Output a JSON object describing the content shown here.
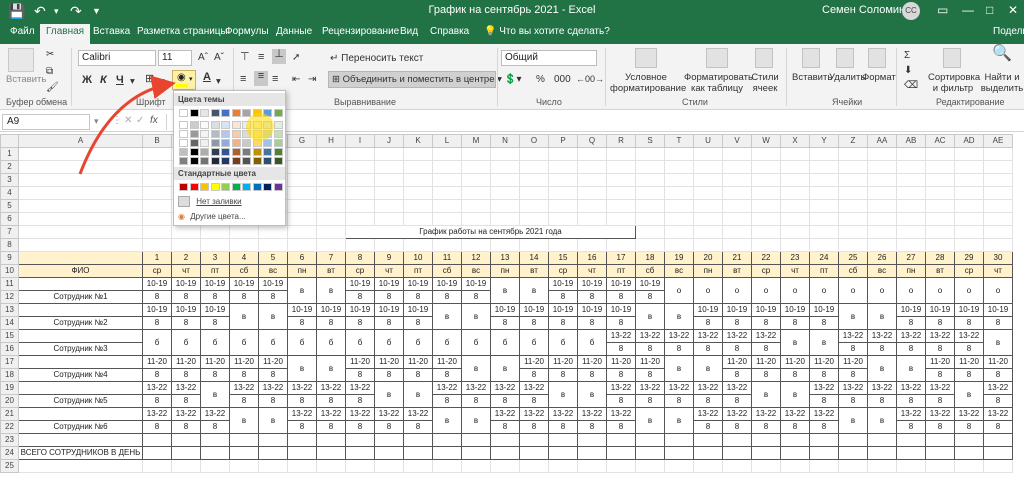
{
  "window": {
    "title": "График на сентябрь 2021  -  Excel",
    "user": "Семен Соломин",
    "avatar": "СС",
    "qat_icons": [
      "save-icon",
      "undo-icon",
      "redo-icon",
      "qat-dropdown-icon"
    ],
    "controls": [
      "ribbon-display-icon",
      "minimize-icon",
      "restore-icon",
      "close-icon"
    ]
  },
  "tabs": [
    "Файл",
    "Главная",
    "Вставка",
    "Разметка страницы",
    "Формулы",
    "Данные",
    "Рецензирование",
    "Вид",
    "Справка"
  ],
  "tell_me": "Что вы хотите сделать?",
  "share": "Поделит",
  "ribbon": {
    "clipboard": {
      "paste": "Вставить",
      "label": "Буфер обмена"
    },
    "font": {
      "name": "Calibri",
      "size": "11",
      "bold": "Ж",
      "italic": "К",
      "underline": "Ч",
      "label": "Шрифт"
    },
    "alignment": {
      "wrap": "Переносить текст",
      "merge": "Объединить и поместить в центре",
      "label": "Выравнивание"
    },
    "number": {
      "format": "Общий",
      "label": "Число"
    },
    "styles": {
      "conditional": "Условное форматирование",
      "as_table": "Форматировать как таблицу",
      "cell_styles": "Стили ячеек",
      "label": "Стили"
    },
    "cells": {
      "insert": "Вставить",
      "delete": "Удалить",
      "format": "Формат",
      "label": "Ячейки"
    },
    "editing": {
      "sort": "Сортировка и фильтр",
      "find": "Найти и выделить",
      "label": "Редактирование"
    }
  },
  "formula_bar": {
    "name_box": "A9",
    "fx": "fx",
    "value": ""
  },
  "fill_dropdown": {
    "theme_title": "Цвета темы",
    "standard_title": "Стандартные цвета",
    "no_fill": "Нет заливки",
    "more_colors": "Другие цвета...",
    "theme_colors": [
      "#ffffff",
      "#000000",
      "#e7e6e6",
      "#44546a",
      "#4472c4",
      "#ed7d31",
      "#a5a5a5",
      "#ffc000",
      "#5b9bd5",
      "#70ad47"
    ],
    "standard_colors": [
      "#c00000",
      "#ff0000",
      "#ffc000",
      "#ffff00",
      "#92d050",
      "#00b050",
      "#00b0f0",
      "#0070c0",
      "#002060",
      "#7030a0"
    ]
  },
  "sheet": {
    "columns": [
      "A",
      "B",
      "C",
      "D",
      "E",
      "F",
      "G",
      "H",
      "I",
      "J",
      "K",
      "L",
      "M",
      "N",
      "O",
      "P",
      "Q",
      "R",
      "S",
      "T",
      "U",
      "V",
      "W",
      "X",
      "Y",
      "Z",
      "AA",
      "AB",
      "AC",
      "AD",
      "AE"
    ],
    "rows": [
      1,
      2,
      3,
      4,
      5,
      6,
      7,
      8,
      9,
      10,
      11,
      12,
      13,
      14,
      15,
      16,
      17,
      18,
      19,
      20,
      21,
      22,
      23,
      24,
      25
    ],
    "schedule_title": "График работы на сентябрь 2021 года",
    "fio_header": "ФИО",
    "days": [
      "1",
      "2",
      "3",
      "4",
      "5",
      "6",
      "7",
      "8",
      "9",
      "10",
      "11",
      "12",
      "13",
      "14",
      "15",
      "16",
      "17",
      "18",
      "19",
      "20",
      "21",
      "22",
      "23",
      "24",
      "25",
      "26",
      "27",
      "28",
      "29",
      "30"
    ],
    "weekdays": [
      "ср",
      "чт",
      "пт",
      "сб",
      "вс",
      "пн",
      "вт",
      "ср",
      "чт",
      "пт",
      "сб",
      "вс",
      "пн",
      "вт",
      "ср",
      "чт",
      "пт",
      "сб",
      "вс",
      "пн",
      "вт",
      "ср",
      "чт",
      "пт",
      "сб",
      "вс",
      "пн",
      "вт",
      "ср",
      "чт"
    ],
    "employees": [
      {
        "name": "Сотрудник №1",
        "cells": [
          "10-19|8",
          "10-19|8",
          "10-19|8",
          "10-19|8",
          "10-19|8",
          "в",
          "в",
          "10-19|8",
          "10-19|8",
          "10-19|8",
          "10-19|8",
          "10-19|8",
          "в",
          "в",
          "10-19|8",
          "10-19|8",
          "10-19|8",
          "10-19|8",
          "о",
          "о",
          "о",
          "о",
          "о",
          "о",
          "о",
          "о",
          "о",
          "о",
          "о",
          "о"
        ]
      },
      {
        "name": "Сотрудник №2",
        "cells": [
          "10-19|8",
          "10-19|8",
          "10-19|8",
          "в",
          "в",
          "10-19|8",
          "10-19|8",
          "10-19|8",
          "10-19|8",
          "10-19|8",
          "в",
          "в",
          "10-19|8",
          "10-19|8",
          "10-19|8",
          "10-19|8",
          "10-19|8",
          "в",
          "в",
          "10-19|8",
          "10-19|8",
          "10-19|8",
          "10-19|8",
          "10-19|8",
          "в",
          "в",
          "10-19|8",
          "10-19|8",
          "10-19|8",
          "10-19|8"
        ]
      },
      {
        "name": "Сотрудник №3",
        "cells": [
          "б",
          "б",
          "б",
          "б",
          "б",
          "б",
          "б",
          "б",
          "б",
          "б",
          "б",
          "б",
          "б",
          "б",
          "б",
          "б",
          "13-22|8",
          "13-22|8",
          "13-22|8",
          "13-22|8",
          "13-22|8",
          "13-22|8",
          "в",
          "в",
          "13-22|8",
          "13-22|8",
          "13-22|8",
          "13-22|8",
          "13-22|8",
          "в"
        ]
      },
      {
        "name": "Сотрудник №4",
        "cells": [
          "11-20|8",
          "11-20|8",
          "11-20|8",
          "11-20|8",
          "11-20|8",
          "в",
          "в",
          "11-20|8",
          "11-20|8",
          "11-20|8",
          "11-20|8",
          "в",
          "в",
          "11-20|8",
          "11-20|8",
          "11-20|8",
          "11-20|8",
          "11-20|8",
          "в",
          "в",
          "11-20|8",
          "11-20|8",
          "11-20|8",
          "11-20|8",
          "11-20|8",
          "в",
          "в",
          "11-20|8",
          "11-20|8",
          "11-20|8"
        ]
      },
      {
        "name": "Сотрудник №5",
        "cells": [
          "13-22|8",
          "13-22|8",
          "в",
          "13-22|8",
          "13-22|8",
          "13-22|8",
          "13-22|8",
          "13-22|8",
          "в",
          "в",
          "13-22|8",
          "13-22|8",
          "13-22|8",
          "13-22|8",
          "в",
          "в",
          "13-22|8",
          "13-22|8",
          "13-22|8",
          "13-22|8",
          "13-22|8",
          "в",
          "в",
          "13-22|8",
          "13-22|8",
          "13-22|8",
          "13-22|8",
          "13-22|8",
          "в",
          "13-22|8"
        ]
      },
      {
        "name": "Сотрудник №6",
        "cells": [
          "13-22|8",
          "13-22|8",
          "13-22|8",
          "в",
          "в",
          "13-22|8",
          "13-22|8",
          "13-22|8",
          "13-22|8",
          "13-22|8",
          "в",
          "в",
          "13-22|8",
          "13-22|8",
          "13-22|8",
          "13-22|8",
          "13-22|8",
          "в",
          "в",
          "13-22|8",
          "13-22|8",
          "13-22|8",
          "13-22|8",
          "13-22|8",
          "в",
          "в",
          "13-22|8",
          "13-22|8",
          "13-22|8",
          "13-22|8"
        ]
      }
    ],
    "total_label": "ВСЕГО СОТРУДНИКОВ В ДЕНЬ"
  }
}
